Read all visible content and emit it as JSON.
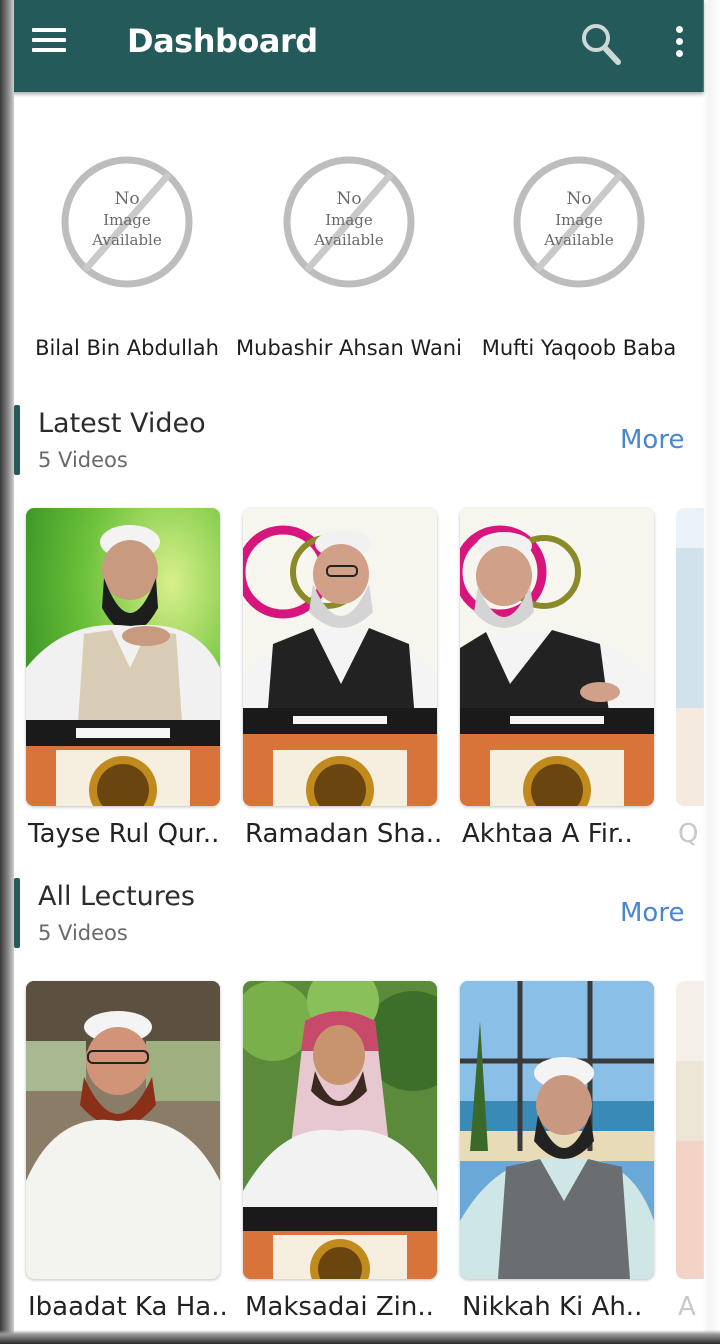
{
  "appbar": {
    "title": "Dashboard",
    "background": "#255a5a",
    "icons": [
      "menu-icon",
      "search-icon",
      "overflow-menu-icon"
    ]
  },
  "scholars": [
    {
      "name": "Bilal Bin Abdullah",
      "placeholder": [
        "No",
        "Image",
        "Available"
      ]
    },
    {
      "name": "Mubashir Ahsan Wani",
      "placeholder": [
        "No",
        "Image",
        "Available"
      ]
    },
    {
      "name": "Mufti Yaqoob Baba",
      "placeholder": [
        "No",
        "Image",
        "Available"
      ]
    }
  ],
  "latest_video": {
    "title": "Latest Video",
    "count": "5 Videos",
    "more": "More",
    "items": [
      "Tayse Rul Qur..",
      "Ramadan Sha..",
      "Akhtaa A Fir.."
    ],
    "peek": "Q"
  },
  "all_lectures": {
    "title": "All Lectures",
    "count": "5 Videos",
    "more": "More",
    "items": [
      "Ibaadat Ka Ha..",
      "Maksadai Zin..",
      "Nikkah Ki Ah.."
    ],
    "peek": "A"
  },
  "colors": {
    "accent": "#255a5a",
    "link": "#4a86cf"
  }
}
